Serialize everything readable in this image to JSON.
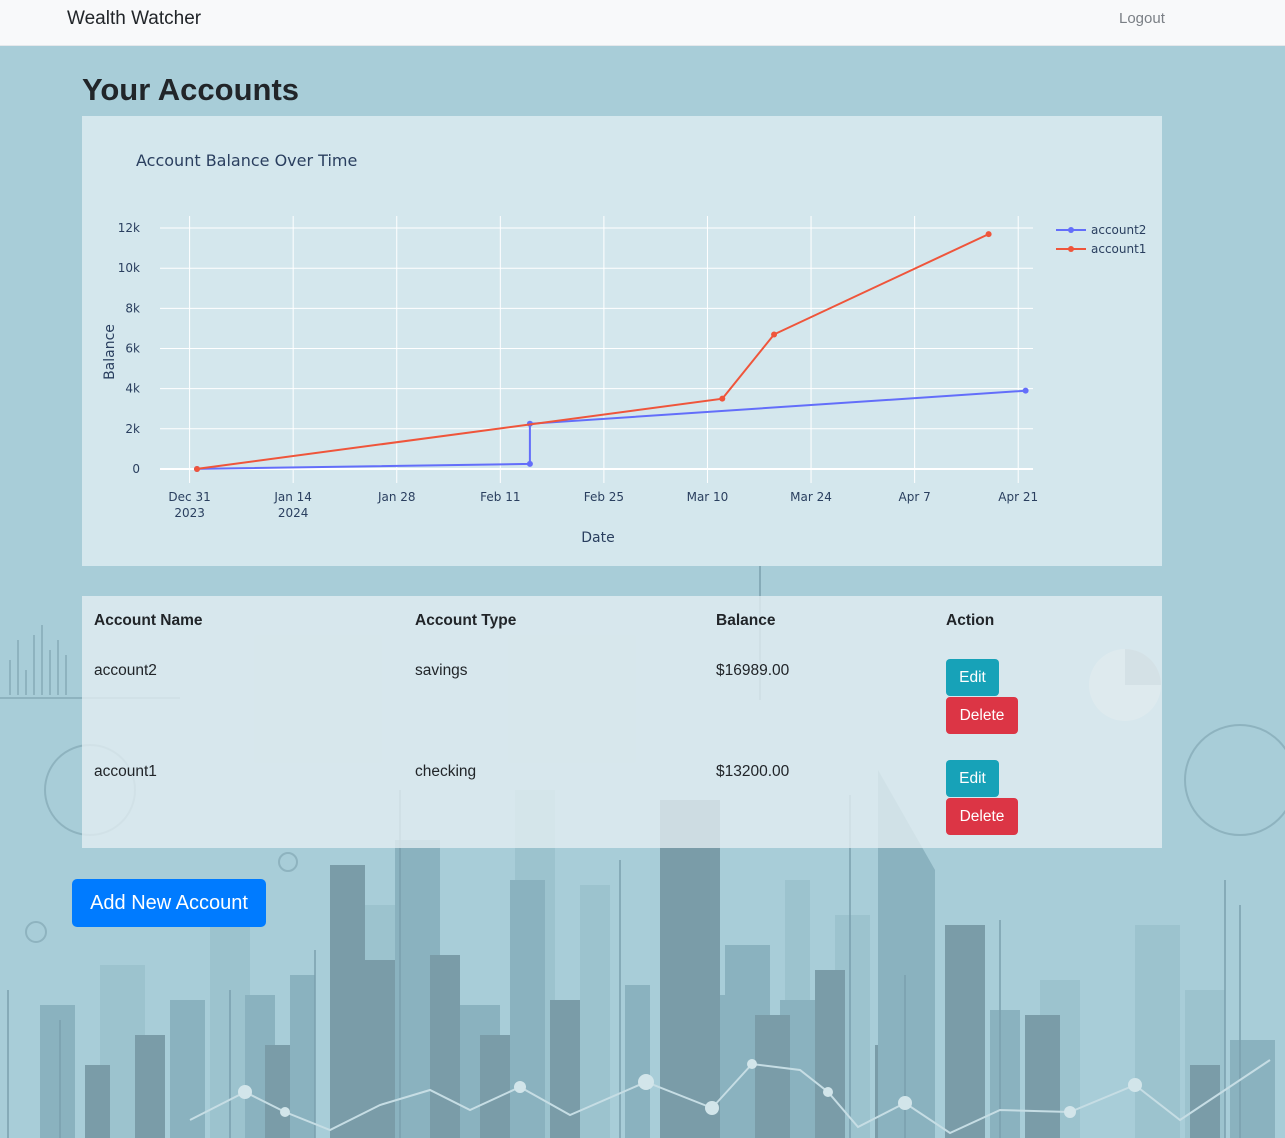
{
  "navbar": {
    "brand": "Wealth Watcher",
    "logout_label": "Logout"
  },
  "page": {
    "title": "Your Accounts"
  },
  "chart_data": {
    "type": "line",
    "title": "Account Balance Over Time",
    "xlabel": "Date",
    "ylabel": "Balance",
    "x_tick_labels": [
      [
        "Dec 31",
        "2023"
      ],
      [
        "Jan 14",
        "2024"
      ],
      [
        "Jan 28"
      ],
      [
        "Feb 11"
      ],
      [
        "Feb 25"
      ],
      [
        "Mar 10"
      ],
      [
        "Mar 24"
      ],
      [
        "Apr 7"
      ],
      [
        "Apr 21"
      ]
    ],
    "y_tick_labels": [
      "0",
      "2k",
      "4k",
      "6k",
      "8k",
      "10k",
      "12k"
    ],
    "ylim": [
      -700,
      12600
    ],
    "xlim": [
      "2023-12-27",
      "2024-04-23"
    ],
    "grid": true,
    "legend_position": "top-right",
    "series": [
      {
        "name": "account2",
        "color": "#636efa",
        "points": [
          {
            "x": "2024-01-01",
            "y": 0
          },
          {
            "x": "2024-02-15",
            "y": 250
          },
          {
            "x": "2024-02-15",
            "y": 2250
          },
          {
            "x": "2024-04-22",
            "y": 3900
          }
        ]
      },
      {
        "name": "account1",
        "color": "#ef553b",
        "points": [
          {
            "x": "2024-01-01",
            "y": 0
          },
          {
            "x": "2024-03-12",
            "y": 3500
          },
          {
            "x": "2024-03-19",
            "y": 6700
          },
          {
            "x": "2024-04-17",
            "y": 11700
          }
        ]
      }
    ]
  },
  "table": {
    "headers": {
      "name": "Account Name",
      "type": "Account Type",
      "balance": "Balance",
      "action": "Action"
    },
    "rows": [
      {
        "name": "account2",
        "type": "savings",
        "balance": "$16989.00",
        "edit_label": "Edit",
        "delete_label": "Delete"
      },
      {
        "name": "account1",
        "type": "checking",
        "balance": "$13200.00",
        "edit_label": "Edit",
        "delete_label": "Delete"
      }
    ]
  },
  "actions": {
    "add_label": "Add New Account"
  }
}
